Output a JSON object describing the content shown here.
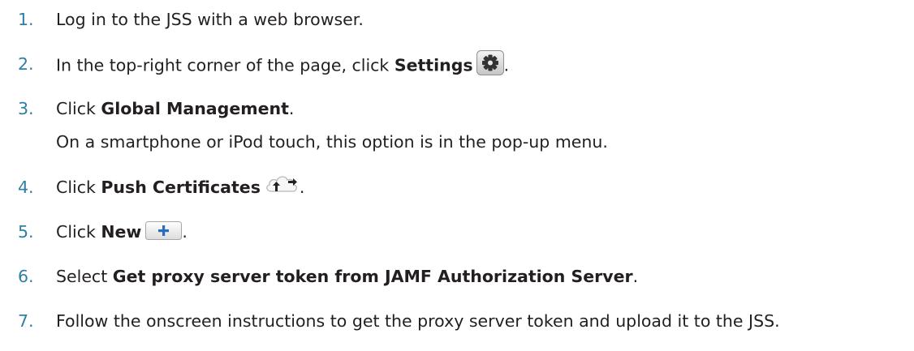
{
  "steps": [
    {
      "num": "1.",
      "text": "Log in to the JSS with a web browser."
    },
    {
      "num": "2.",
      "pre": "In the top-right corner of the page, click ",
      "bold": "Settings",
      "post": ".",
      "icon": "gear-icon"
    },
    {
      "num": "3.",
      "pre": "Click ",
      "bold": "Global Management",
      "post": ".",
      "note": "On a smartphone or iPod touch, this option is in the pop-up menu."
    },
    {
      "num": "4.",
      "pre": "Click ",
      "bold": "Push Certificates",
      "post": ".",
      "icon": "cloud-upload-icon"
    },
    {
      "num": "5.",
      "pre": "Click ",
      "bold": "New",
      "post": ".",
      "icon": "plus-icon"
    },
    {
      "num": "6.",
      "pre": "Select ",
      "bold": "Get proxy server token from JAMF Authorization Server",
      "post": "."
    },
    {
      "num": "7.",
      "text": "Follow the onscreen instructions to get the proxy server token and upload it to the JSS."
    }
  ],
  "colors": {
    "step_number": "#2e7fa6",
    "body_text": "#231f20",
    "plus_icon": "#2a6ebb"
  }
}
